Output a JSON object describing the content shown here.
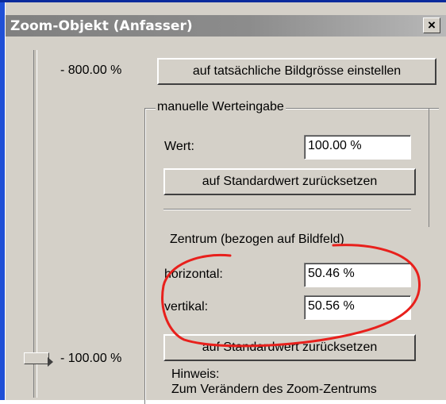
{
  "window": {
    "title": "Zoom-Objekt (Anfasser)",
    "close_glyph": "×"
  },
  "slider": {
    "max_label": "- 800.00 %",
    "current_label": "- 100.00 %"
  },
  "buttons": {
    "actual_size": "auf tatsächliche Bildgrösse einstellen",
    "reset_value": "auf Standardwert zurücksetzen",
    "reset_center": "auf Standardwert zurücksetzen"
  },
  "manual": {
    "group_title": "manuelle Werteingabe",
    "value_label": "Wert:",
    "value": "100.00 %"
  },
  "center": {
    "title": "Zentrum (bezogen auf Bildfeld)",
    "horizontal_label": "horizontal:",
    "horizontal_value": "50.46 %",
    "vertical_label": "vertikal:",
    "vertical_value": "50.56 %"
  },
  "hint": {
    "title": "Hinweis:",
    "text": "Zum Verändern des Zoom-Zentrums"
  },
  "annotation": {
    "color": "#e8201c"
  },
  "colors": {
    "dialog_bg": "#d4d0c8",
    "titlebar": "#808080",
    "window_edge": "#1f4fd6"
  }
}
